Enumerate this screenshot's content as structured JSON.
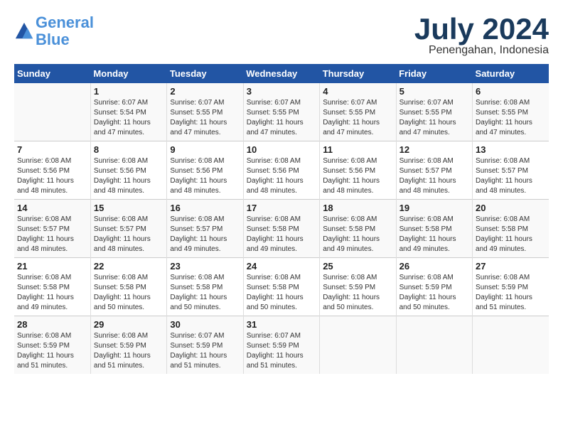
{
  "header": {
    "logo_line1": "General",
    "logo_line2": "Blue",
    "month": "July 2024",
    "location": "Penengahan, Indonesia"
  },
  "days_of_week": [
    "Sunday",
    "Monday",
    "Tuesday",
    "Wednesday",
    "Thursday",
    "Friday",
    "Saturday"
  ],
  "weeks": [
    [
      {
        "num": "",
        "info": ""
      },
      {
        "num": "1",
        "info": "Sunrise: 6:07 AM\nSunset: 5:54 PM\nDaylight: 11 hours\nand 47 minutes."
      },
      {
        "num": "2",
        "info": "Sunrise: 6:07 AM\nSunset: 5:55 PM\nDaylight: 11 hours\nand 47 minutes."
      },
      {
        "num": "3",
        "info": "Sunrise: 6:07 AM\nSunset: 5:55 PM\nDaylight: 11 hours\nand 47 minutes."
      },
      {
        "num": "4",
        "info": "Sunrise: 6:07 AM\nSunset: 5:55 PM\nDaylight: 11 hours\nand 47 minutes."
      },
      {
        "num": "5",
        "info": "Sunrise: 6:07 AM\nSunset: 5:55 PM\nDaylight: 11 hours\nand 47 minutes."
      },
      {
        "num": "6",
        "info": "Sunrise: 6:08 AM\nSunset: 5:55 PM\nDaylight: 11 hours\nand 47 minutes."
      }
    ],
    [
      {
        "num": "7",
        "info": "Sunrise: 6:08 AM\nSunset: 5:56 PM\nDaylight: 11 hours\nand 48 minutes."
      },
      {
        "num": "8",
        "info": "Sunrise: 6:08 AM\nSunset: 5:56 PM\nDaylight: 11 hours\nand 48 minutes."
      },
      {
        "num": "9",
        "info": "Sunrise: 6:08 AM\nSunset: 5:56 PM\nDaylight: 11 hours\nand 48 minutes."
      },
      {
        "num": "10",
        "info": "Sunrise: 6:08 AM\nSunset: 5:56 PM\nDaylight: 11 hours\nand 48 minutes."
      },
      {
        "num": "11",
        "info": "Sunrise: 6:08 AM\nSunset: 5:56 PM\nDaylight: 11 hours\nand 48 minutes."
      },
      {
        "num": "12",
        "info": "Sunrise: 6:08 AM\nSunset: 5:57 PM\nDaylight: 11 hours\nand 48 minutes."
      },
      {
        "num": "13",
        "info": "Sunrise: 6:08 AM\nSunset: 5:57 PM\nDaylight: 11 hours\nand 48 minutes."
      }
    ],
    [
      {
        "num": "14",
        "info": "Sunrise: 6:08 AM\nSunset: 5:57 PM\nDaylight: 11 hours\nand 48 minutes."
      },
      {
        "num": "15",
        "info": "Sunrise: 6:08 AM\nSunset: 5:57 PM\nDaylight: 11 hours\nand 48 minutes."
      },
      {
        "num": "16",
        "info": "Sunrise: 6:08 AM\nSunset: 5:57 PM\nDaylight: 11 hours\nand 49 minutes."
      },
      {
        "num": "17",
        "info": "Sunrise: 6:08 AM\nSunset: 5:58 PM\nDaylight: 11 hours\nand 49 minutes."
      },
      {
        "num": "18",
        "info": "Sunrise: 6:08 AM\nSunset: 5:58 PM\nDaylight: 11 hours\nand 49 minutes."
      },
      {
        "num": "19",
        "info": "Sunrise: 6:08 AM\nSunset: 5:58 PM\nDaylight: 11 hours\nand 49 minutes."
      },
      {
        "num": "20",
        "info": "Sunrise: 6:08 AM\nSunset: 5:58 PM\nDaylight: 11 hours\nand 49 minutes."
      }
    ],
    [
      {
        "num": "21",
        "info": "Sunrise: 6:08 AM\nSunset: 5:58 PM\nDaylight: 11 hours\nand 49 minutes."
      },
      {
        "num": "22",
        "info": "Sunrise: 6:08 AM\nSunset: 5:58 PM\nDaylight: 11 hours\nand 50 minutes."
      },
      {
        "num": "23",
        "info": "Sunrise: 6:08 AM\nSunset: 5:58 PM\nDaylight: 11 hours\nand 50 minutes."
      },
      {
        "num": "24",
        "info": "Sunrise: 6:08 AM\nSunset: 5:58 PM\nDaylight: 11 hours\nand 50 minutes."
      },
      {
        "num": "25",
        "info": "Sunrise: 6:08 AM\nSunset: 5:59 PM\nDaylight: 11 hours\nand 50 minutes."
      },
      {
        "num": "26",
        "info": "Sunrise: 6:08 AM\nSunset: 5:59 PM\nDaylight: 11 hours\nand 50 minutes."
      },
      {
        "num": "27",
        "info": "Sunrise: 6:08 AM\nSunset: 5:59 PM\nDaylight: 11 hours\nand 51 minutes."
      }
    ],
    [
      {
        "num": "28",
        "info": "Sunrise: 6:08 AM\nSunset: 5:59 PM\nDaylight: 11 hours\nand 51 minutes."
      },
      {
        "num": "29",
        "info": "Sunrise: 6:08 AM\nSunset: 5:59 PM\nDaylight: 11 hours\nand 51 minutes."
      },
      {
        "num": "30",
        "info": "Sunrise: 6:07 AM\nSunset: 5:59 PM\nDaylight: 11 hours\nand 51 minutes."
      },
      {
        "num": "31",
        "info": "Sunrise: 6:07 AM\nSunset: 5:59 PM\nDaylight: 11 hours\nand 51 minutes."
      },
      {
        "num": "",
        "info": ""
      },
      {
        "num": "",
        "info": ""
      },
      {
        "num": "",
        "info": ""
      }
    ]
  ]
}
